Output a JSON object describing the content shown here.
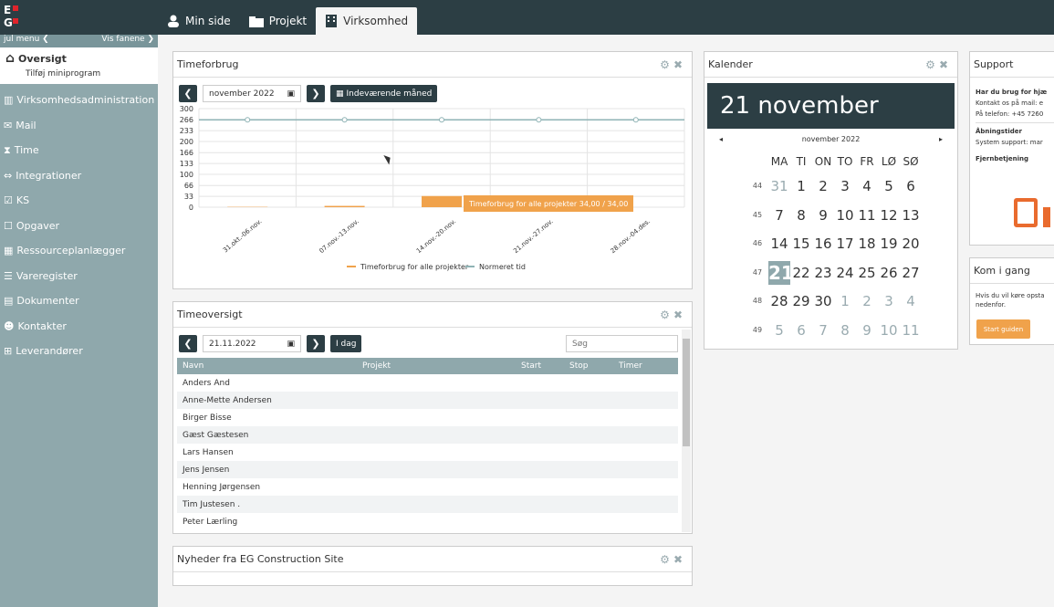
{
  "tabs": [
    {
      "label": "Min side"
    },
    {
      "label": "Projekt"
    },
    {
      "label": "Virksomhed"
    }
  ],
  "sidebar": {
    "hide_menu": "jul menu ❮",
    "show_tabs": "Vis fanene ❯",
    "overview_title": "Oversigt",
    "overview_sub": "Tilføj miniprogram",
    "items": [
      {
        "label": "Virksomhedsadministration"
      },
      {
        "label": "Mail"
      },
      {
        "label": "Time"
      },
      {
        "label": "Integrationer"
      },
      {
        "label": "KS"
      },
      {
        "label": "Opgaver"
      },
      {
        "label": "Ressourceplanlægger"
      },
      {
        "label": "Vareregister"
      },
      {
        "label": "Dokumenter"
      },
      {
        "label": "Kontakter"
      },
      {
        "label": "Leverandører"
      }
    ]
  },
  "time_usage": {
    "title": "Timeforbrug",
    "month": "november 2022",
    "current_month_btn": "Indeværende måned",
    "tooltip": "Timeforbrug for alle projekter 34,00 / 34,00"
  },
  "chart_data": {
    "type": "bar",
    "categories": [
      "31.okt.-06.nov.",
      "07.nov.-13.nov.",
      "14.nov.-20.nov.",
      "21.nov.-27.nov.",
      "28.nov.-04.des."
    ],
    "series": [
      {
        "name": "Timeforbrug for alle projekter",
        "values": [
          1,
          4,
          34,
          0,
          0
        ],
        "color": "#f0a24b"
      },
      {
        "name": "Normeret tid",
        "values": [
          266,
          266,
          266,
          266,
          266
        ],
        "color": "#8fb3b5"
      }
    ],
    "yticks": [
      "300",
      "266",
      "233",
      "200",
      "166",
      "133",
      "100",
      "66",
      "33",
      "0"
    ],
    "ylim": [
      0,
      300
    ]
  },
  "time_overview": {
    "title": "Timeoversigt",
    "date": "21.11.2022",
    "today_btn": "I dag",
    "search_placeholder": "Søg",
    "columns": [
      "Navn",
      "Projekt",
      "Start",
      "Stop",
      "Timer"
    ],
    "rows": [
      "Anders And",
      "Anne-Mette Andersen",
      "Birger Bisse",
      "Gæst Gæstesen",
      "Lars Hansen",
      "Jens Jensen",
      "Henning Jørgensen",
      "Tim Justesen .",
      "Peter Lærling"
    ]
  },
  "news": {
    "title": "Nyheder fra EG Construction Site"
  },
  "calendar": {
    "title": "Kalender",
    "big_date": "21 november",
    "month": "november 2022",
    "days": [
      "MA",
      "TI",
      "ON",
      "TO",
      "FR",
      "LØ",
      "SØ"
    ],
    "weeks": [
      {
        "w": "44",
        "d": [
          "31",
          "1",
          "2",
          "3",
          "4",
          "5",
          "6"
        ]
      },
      {
        "w": "45",
        "d": [
          "7",
          "8",
          "9",
          "10",
          "11",
          "12",
          "13"
        ]
      },
      {
        "w": "46",
        "d": [
          "14",
          "15",
          "16",
          "17",
          "18",
          "19",
          "20"
        ]
      },
      {
        "w": "47",
        "d": [
          "21",
          "22",
          "23",
          "24",
          "25",
          "26",
          "27"
        ]
      },
      {
        "w": "48",
        "d": [
          "28",
          "29",
          "30",
          "1",
          "2",
          "3",
          "4"
        ]
      },
      {
        "w": "49",
        "d": [
          "5",
          "6",
          "7",
          "8",
          "9",
          "10",
          "11"
        ]
      }
    ]
  },
  "support": {
    "title": "Support",
    "heading": "Har du brug for hjæ",
    "mail": "Kontakt os på mail: e",
    "phone": "På telefon: +45 7260",
    "hours_h": "Åbningstider",
    "hours": "System support: mar",
    "remote_h": "Fjernbetjening"
  },
  "getting_started": {
    "title": "Kom i gang",
    "text1": "Hvis du vil køre opsta",
    "text2": "nedenfor.",
    "btn": "Start guiden"
  }
}
